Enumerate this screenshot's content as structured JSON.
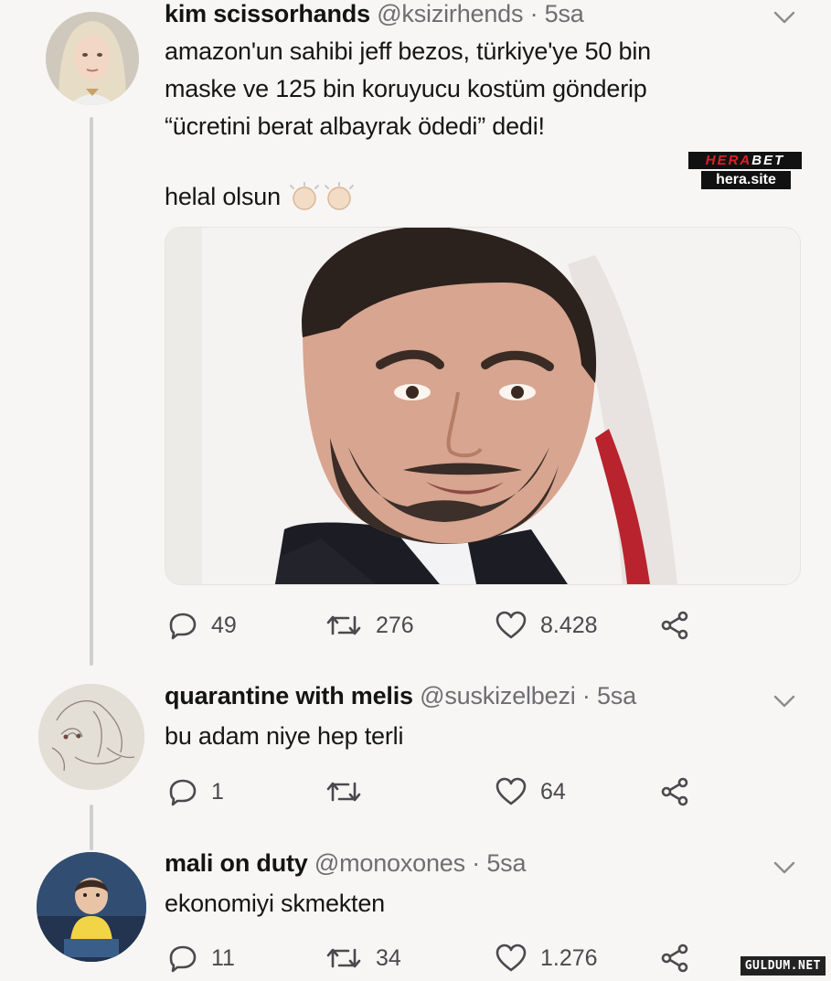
{
  "tweets": [
    {
      "name": "kim scissorhands",
      "handle": "@ksizirhends",
      "time": "· 5sa",
      "text_lines": [
        "amazon'un sahibi jeff bezos, türkiye'ye 50 bin",
        "maske ve 125 bin koruyucu kostüm gönderip",
        "“ücretini berat albayrak ödedi” dedi!"
      ],
      "text_extra": "helal olsun",
      "emoji": "clapping-hands-emoji",
      "media_description_icon": "portrait-photo",
      "actions": {
        "reply": "49",
        "retweet": "276",
        "like": "8.428"
      }
    },
    {
      "name": "quarantine with melis",
      "handle": "@suskizelbezi",
      "time": "· 5sa",
      "text": "bu adam niye hep terli",
      "actions": {
        "reply": "1",
        "retweet": "",
        "like": "64"
      }
    },
    {
      "name": "mali on duty",
      "handle": "@monoxones",
      "time": "· 5sa",
      "text": "ekonomiyi skmekten",
      "actions": {
        "reply": "11",
        "retweet": "34",
        "like": "1.276"
      }
    }
  ],
  "overlay": {
    "brand_top_a": "HERA",
    "brand_top_b": "BET",
    "brand_bottom": "hera.site",
    "watermark": "GULDUM.NET"
  },
  "colors": {
    "background": "#f7f6f4",
    "thread_line": "#cfcfd2",
    "muted": "#6e6e72",
    "brand_red": "#e0202a"
  }
}
